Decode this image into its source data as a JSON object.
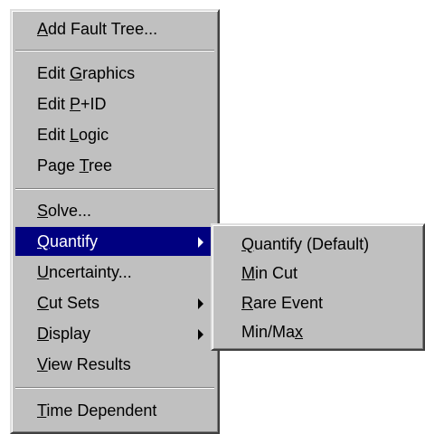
{
  "main_menu": {
    "items": [
      {
        "pre": "",
        "key": "A",
        "post": "dd Fault Tree..."
      },
      {
        "pre": "Edit ",
        "key": "G",
        "post": "raphics"
      },
      {
        "pre": "Edit ",
        "key": "P",
        "post": "+ID"
      },
      {
        "pre": "Edit ",
        "key": "L",
        "post": "ogic"
      },
      {
        "pre": "Page ",
        "key": "T",
        "post": "ree"
      },
      {
        "pre": "",
        "key": "S",
        "post": "olve..."
      },
      {
        "pre": "",
        "key": "Q",
        "post": "uantify"
      },
      {
        "pre": "",
        "key": "U",
        "post": "ncertainty..."
      },
      {
        "pre": "",
        "key": "C",
        "post": "ut Sets"
      },
      {
        "pre": "",
        "key": "D",
        "post": "isplay"
      },
      {
        "pre": "",
        "key": "V",
        "post": "iew Results"
      },
      {
        "pre": "",
        "key": "T",
        "post": "ime Dependent"
      }
    ]
  },
  "submenu": {
    "items": [
      {
        "pre": "",
        "key": "Q",
        "post": "uantify (Default)"
      },
      {
        "pre": "",
        "key": "M",
        "post": "in Cut"
      },
      {
        "pre": "",
        "key": "R",
        "post": "are Event"
      },
      {
        "pre": "Min/Ma",
        "key": "x",
        "post": ""
      }
    ]
  },
  "colors": {
    "menu_bg": "#c0c0c0",
    "highlight_bg": "#000080",
    "highlight_text": "#ffffff"
  }
}
